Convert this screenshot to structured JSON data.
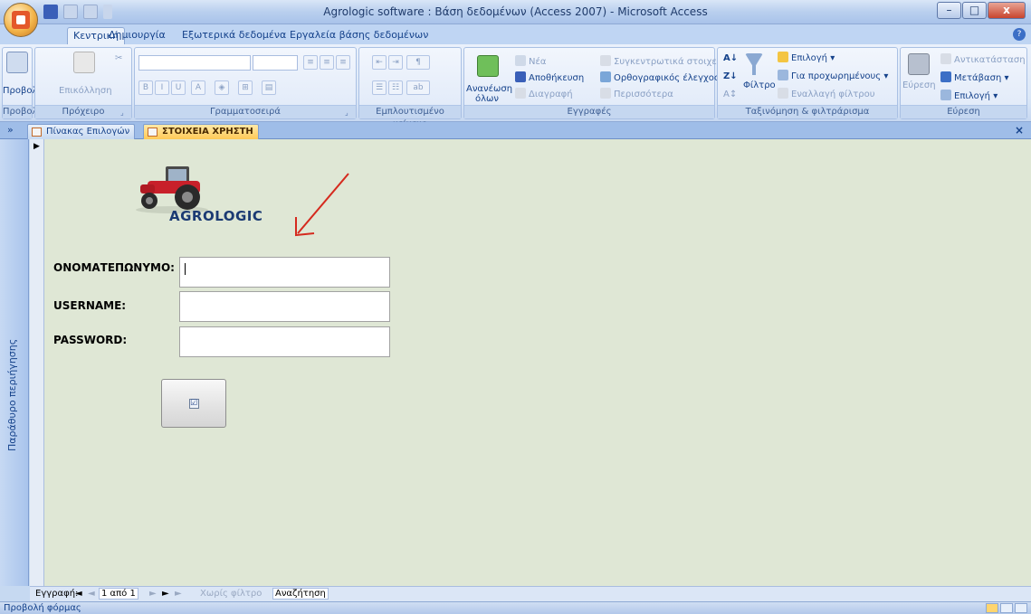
{
  "window": {
    "title": "Agrologic software : Βάση δεδομένων (Access 2007) - Microsoft Access",
    "minimize": "–",
    "maximize": "□",
    "close": "x"
  },
  "ribbon_tabs": [
    "Κεντρική",
    "Δημιουργία",
    "Εξωτερικά δεδομένα",
    "Εργαλεία βάσης δεδομένων"
  ],
  "ribbon": {
    "views": {
      "view_label": "Προβολή",
      "group_label": "Προβολές"
    },
    "clipboard": {
      "paste_label": "Επικόλληση",
      "group_label": "Πρόχειρο"
    },
    "font": {
      "group_label": "Γραμματοσειρά"
    },
    "rich_text": {
      "group_label": "Εμπλουτισμένο κείμενο"
    },
    "records": {
      "refresh_label": "Ανανέωση όλων",
      "new_label": "Νέα",
      "save_label": "Αποθήκευση",
      "delete_label": "Διαγραφή",
      "totals_label": "Συγκεντρωτικά στοιχεία",
      "spelling_label": "Ορθογραφικός έλεγχος",
      "more_label": "Περισσότερα",
      "group_label": "Εγγραφές"
    },
    "sort_filter": {
      "filter_label": "Φίλτρο",
      "selection_label": "Επιλογή",
      "advanced_label": "Για προχωρημένους",
      "toggle_filter_label": "Εναλλαγή φίλτρου",
      "group_label": "Ταξινόμηση & φιλτράρισμα"
    },
    "find": {
      "find_label": "Εύρεση",
      "replace_label": "Αντικατάσταση",
      "goto_label": "Μετάβαση",
      "select_label": "Επιλογή",
      "group_label": "Εύρεση"
    }
  },
  "document_tabs": [
    "Πίνακας Επιλογών",
    "ΣΤΟΙΧΕΙΑ ΧΡΗΣΤΗ"
  ],
  "nav_pane_label": "Παράθυρο περιήγησης",
  "form": {
    "logo_text": "AGROLOGIC",
    "fields": [
      {
        "label": "ΟΝΟΜΑΤΕΠΩΝΥΜΟ:",
        "value": ""
      },
      {
        "label": "USERNAME:",
        "value": ""
      },
      {
        "label": "PASSWORD:",
        "value": ""
      }
    ],
    "submit_icon": "☑"
  },
  "record_nav": {
    "label": "Εγγραφή:",
    "first": "◄",
    "prev": "◄",
    "position": "1 από 1",
    "next": "►",
    "last": "►",
    "new": "►",
    "filter_text": "Χωρίς φίλτρο",
    "search_text": "Αναζήτηση"
  },
  "status_bar": {
    "text": "Προβολή φόρμας"
  }
}
